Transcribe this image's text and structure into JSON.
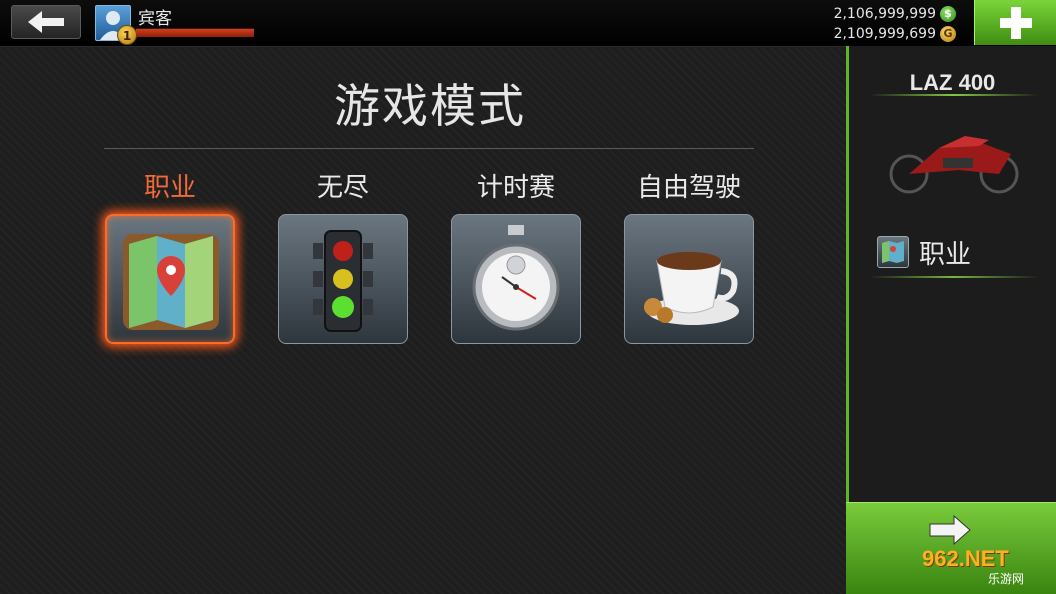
{
  "header": {
    "player_name": "宾客",
    "player_level": "1",
    "xp_progress_percent": 100,
    "cash_amount": "2,106,999,999",
    "cash_icon_glyph": "$",
    "gold_amount": "2,109,999,699",
    "gold_icon_glyph": "G",
    "icons": {
      "back": "back-arrow-icon",
      "avatar": "player-avatar-icon",
      "add": "plus-icon"
    }
  },
  "main": {
    "title": "游戏模式",
    "modes": [
      {
        "label": "职业",
        "icon": "map-icon",
        "selected": true
      },
      {
        "label": "无尽",
        "icon": "traffic-light-icon",
        "selected": false
      },
      {
        "label": "计时赛",
        "icon": "stopwatch-icon",
        "selected": false
      },
      {
        "label": "自由驾驶",
        "icon": "coffee-cup-icon",
        "selected": false
      }
    ]
  },
  "side_panel": {
    "bike_name": "LAZ 400",
    "bike_icon": "motorcycle-icon",
    "selected_mode_label": "职业",
    "selected_mode_icon": "map-icon"
  },
  "next_button": {
    "icon": "forward-arrow-icon"
  },
  "watermark": {
    "main": "962.NET",
    "sub": "乐游网"
  },
  "colors": {
    "accent_green": "#5fb52a",
    "active_orange": "#ff6a2a",
    "xp_red": "#c8401c"
  }
}
